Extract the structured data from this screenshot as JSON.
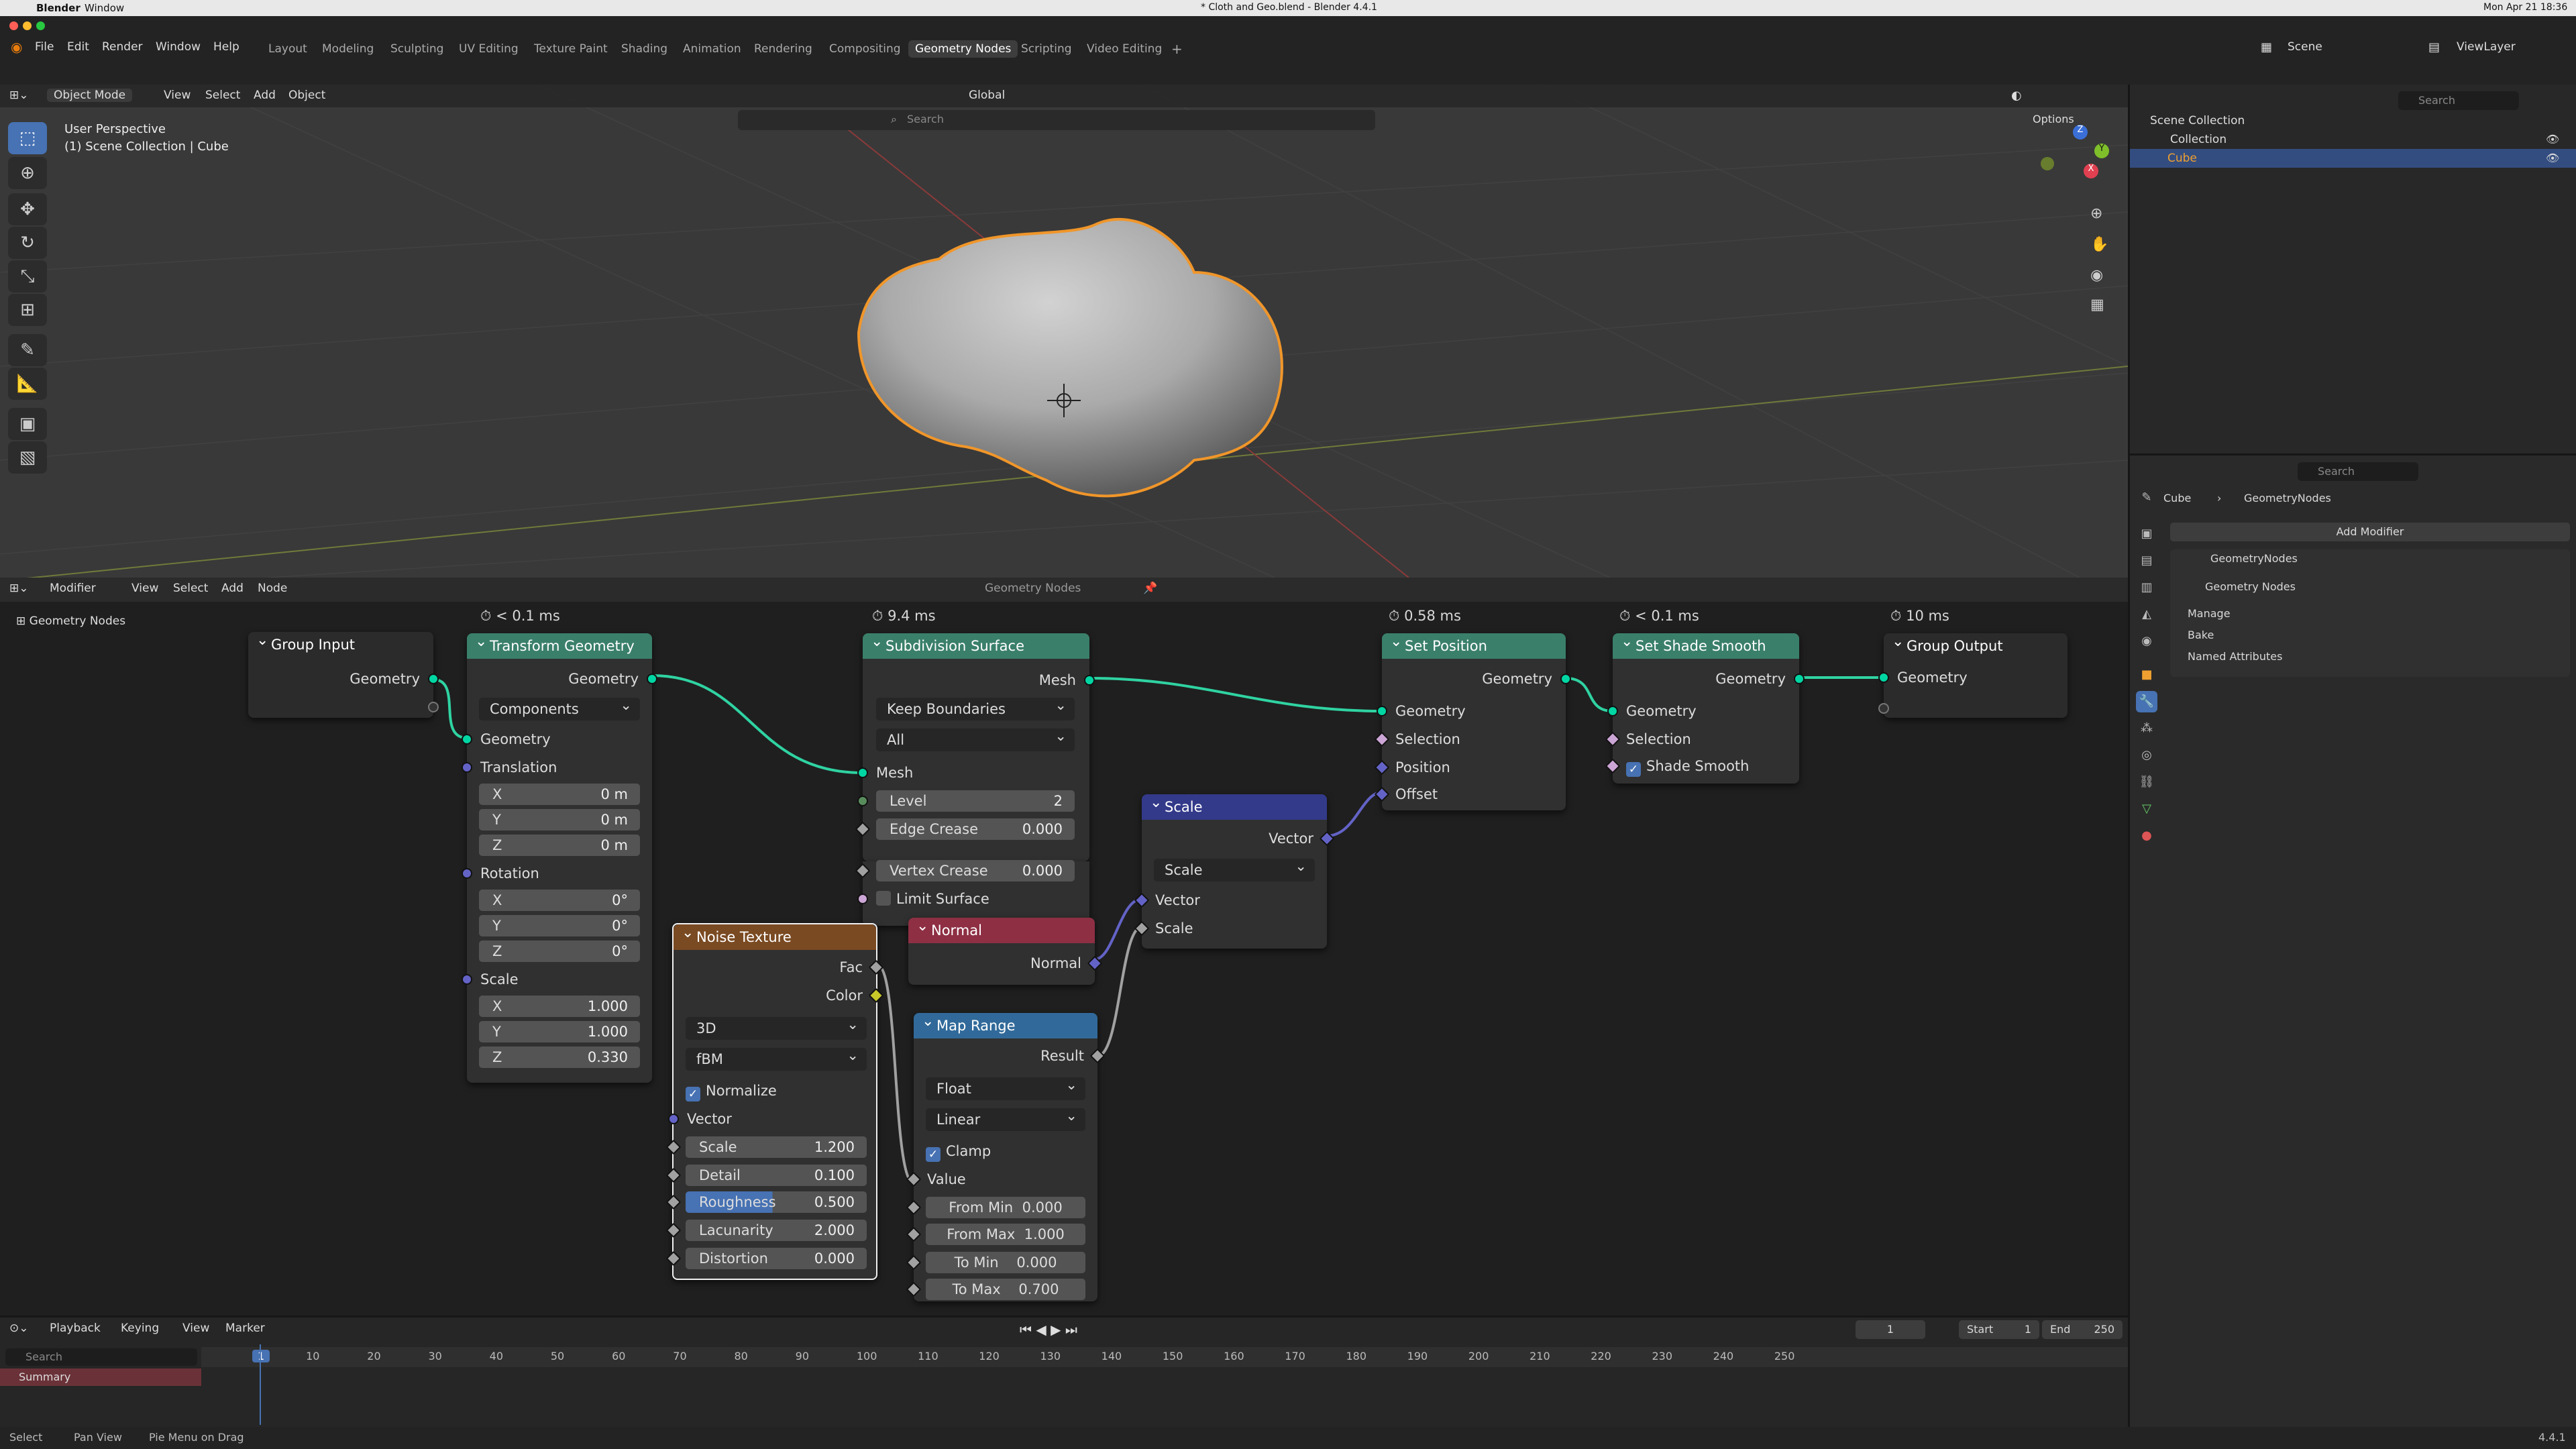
{
  "menubar": {
    "app": "Blender",
    "window": "Window",
    "title": "* Cloth and Geo.blend - Blender 4.4.1",
    "datetime": "Mon Apr 21 18:36"
  },
  "top": {
    "menus": [
      "File",
      "Edit",
      "Render",
      "Window",
      "Help"
    ],
    "workspaces": [
      "Layout",
      "Modeling",
      "Sculpting",
      "UV Editing",
      "Texture Paint",
      "Shading",
      "Animation",
      "Rendering",
      "Compositing",
      "Geometry Nodes",
      "Scripting",
      "Video Editing"
    ],
    "active_ws": "Geometry Nodes",
    "scene": "Scene",
    "viewlayer": "ViewLayer"
  },
  "viewport": {
    "mode": "Object Mode",
    "menus": [
      "View",
      "Select",
      "Add",
      "Object"
    ],
    "transform": "Global",
    "search_placeholder": "Search",
    "options": "Options",
    "overlay1": "User Perspective",
    "overlay2": "(1) Scene Collection | Cube"
  },
  "outliner": {
    "search": "Search",
    "scene_collection": "Scene Collection",
    "collection": "Collection",
    "cube": "Cube"
  },
  "props": {
    "search": "Search",
    "breadcrumb_obj": "Cube",
    "breadcrumb_mod": "GeometryNodes",
    "add_modifier": "Add Modifier",
    "modifier_name": "GeometryNodes",
    "node_group": "Geometry Nodes",
    "sections": [
      "Manage",
      "Bake",
      "Named Attributes"
    ]
  },
  "nodeeditor": {
    "type": "Modifier",
    "menus": [
      "View",
      "Select",
      "Add",
      "Node"
    ],
    "group": "Geometry Nodes",
    "breadcrumb": "Geometry Nodes"
  },
  "nodes": {
    "group_input": {
      "title": "Group Input",
      "out": "Geometry"
    },
    "transform": {
      "timing": "< 0.1 ms",
      "title": "Transform Geometry",
      "out": "Geometry",
      "mode": "Components",
      "in": "Geometry",
      "translation": "Translation",
      "tx": "0 m",
      "ty": "0 m",
      "tz": "0 m",
      "rotation": "Rotation",
      "rx": "0°",
      "ry": "0°",
      "rz": "0°",
      "scale": "Scale",
      "sx": "1.000",
      "sy": "1.000",
      "sz": "0.330"
    },
    "subdiv": {
      "timing": "9.4 ms",
      "title": "Subdivision Surface",
      "out": "Mesh",
      "boundary": "Keep Boundaries",
      "uv": "All",
      "in": "Mesh",
      "level_k": "Level",
      "level_v": "2",
      "edge_k": "Edge Crease",
      "edge_v": "0.000",
      "vert_k": "Vertex Crease",
      "vert_v": "0.000",
      "limit": "Limit Surface"
    },
    "setpos": {
      "timing": "0.58 ms",
      "title": "Set Position",
      "out": "Geometry",
      "in": "Geometry",
      "sel": "Selection",
      "pos": "Position",
      "off": "Offset"
    },
    "shade": {
      "timing": "< 0.1 ms",
      "title": "Set Shade Smooth",
      "out": "Geometry",
      "in": "Geometry",
      "sel": "Selection",
      "smooth": "Shade Smooth"
    },
    "group_output": {
      "timing": "10 ms",
      "title": "Group Output",
      "in": "Geometry"
    },
    "vscale": {
      "title": "Scale",
      "out": "Vector",
      "op": "Scale",
      "in": "Vector",
      "scale": "Scale"
    },
    "normal": {
      "title": "Normal",
      "out": "Normal"
    },
    "noise": {
      "title": "Noise Texture",
      "fac": "Fac",
      "color": "Color",
      "dim": "3D",
      "type": "fBM",
      "normalize": "Normalize",
      "vector": "Vector",
      "scale_k": "Scale",
      "scale_v": "1.200",
      "detail_k": "Detail",
      "detail_v": "0.100",
      "rough_k": "Roughness",
      "rough_v": "0.500",
      "lac_k": "Lacunarity",
      "lac_v": "2.000",
      "dist_k": "Distortion",
      "dist_v": "0.000"
    },
    "maprange": {
      "title": "Map Range",
      "out": "Result",
      "dtype": "Float",
      "interp": "Linear",
      "clamp": "Clamp",
      "value": "Value",
      "fmin_k": "From Min",
      "fmin_v": "0.000",
      "fmax_k": "From Max",
      "fmax_v": "1.000",
      "tmin_k": "To Min",
      "tmin_v": "0.000",
      "tmax_k": "To Max",
      "tmax_v": "0.700"
    }
  },
  "timeline": {
    "menus": [
      "Playback",
      "Keying",
      "View",
      "Marker"
    ],
    "frame": "1",
    "start_k": "Start",
    "start_v": "1",
    "end_k": "End",
    "end_v": "250",
    "search": "Search",
    "summary": "Summary",
    "ticks": [
      "1",
      "10",
      "20",
      "30",
      "40",
      "50",
      "60",
      "70",
      "80",
      "90",
      "100",
      "110",
      "120",
      "130",
      "140",
      "150",
      "160",
      "170",
      "180",
      "190",
      "200",
      "210",
      "220",
      "230",
      "240",
      "250"
    ]
  },
  "status": {
    "select": "Select",
    "pan": "Pan View",
    "pie": "Pie Menu on Drag",
    "version": "4.4.1"
  }
}
